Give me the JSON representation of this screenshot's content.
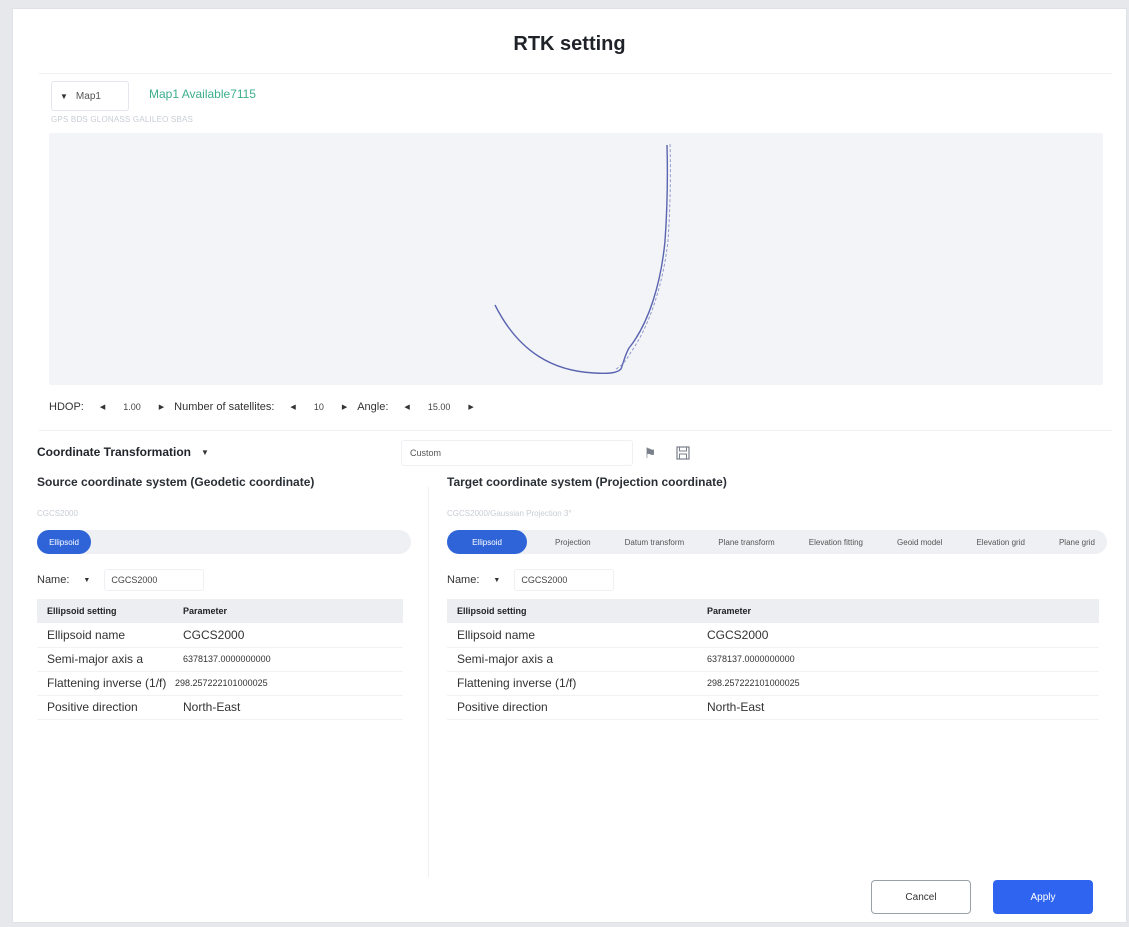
{
  "dialog": {
    "title": "RTK setting"
  },
  "map": {
    "selected": "Map1",
    "available": "Map1 Available7115",
    "subtext": "GPS BDS GLONASS GALILEO SBAS"
  },
  "params": {
    "hdop_label": "HDOP:",
    "hdop_value": "1.00",
    "satellites_label": "Number of satellites:",
    "satellites_value": "10",
    "angle_label": "Angle:",
    "angle_value": "15.00"
  },
  "transform": {
    "label": "Coordinate Transformation",
    "custom_value": "Custom"
  },
  "source": {
    "heading": "Source coordinate system (Geodetic coordinate)",
    "subtext": "CGCS2000",
    "tabs": [
      "Ellipsoid"
    ],
    "name_label": "Name:",
    "name_value": "CGCS2000",
    "table": {
      "headers": [
        "Ellipsoid setting",
        "Parameter"
      ],
      "rows": [
        [
          "Ellipsoid name",
          "CGCS2000"
        ],
        [
          "Semi-major axis a",
          "6378137.0000000000"
        ],
        [
          "Flattening inverse (1/f)",
          "298.257222101000025"
        ],
        [
          "Positive direction",
          "North-East"
        ]
      ]
    }
  },
  "target": {
    "heading": "Target coordinate system (Projection coordinate)",
    "subtext": "CGCS2000/Gaussian Projection 3°",
    "tabs": [
      "Ellipsoid",
      "Projection",
      "Datum transform",
      "Plane transform",
      "Elevation fitting",
      "Geoid model",
      "Elevation grid",
      "Plane grid"
    ],
    "name_label": "Name:",
    "name_value": "CGCS2000",
    "table": {
      "headers": [
        "Ellipsoid setting",
        "Parameter"
      ],
      "rows": [
        [
          "Ellipsoid name",
          "CGCS2000"
        ],
        [
          "Semi-major axis a",
          "6378137.0000000000"
        ],
        [
          "Flattening inverse (1/f)",
          "298.257222101000025"
        ],
        [
          "Positive direction",
          "North-East"
        ]
      ]
    }
  },
  "buttons": {
    "cancel": "Cancel",
    "apply": "Apply"
  },
  "colors": {
    "accent": "#2f64f0",
    "available_text": "#3dae8c",
    "track": "#5a64b0"
  },
  "icons": {
    "flag": "flag-icon",
    "save": "save-icon"
  }
}
